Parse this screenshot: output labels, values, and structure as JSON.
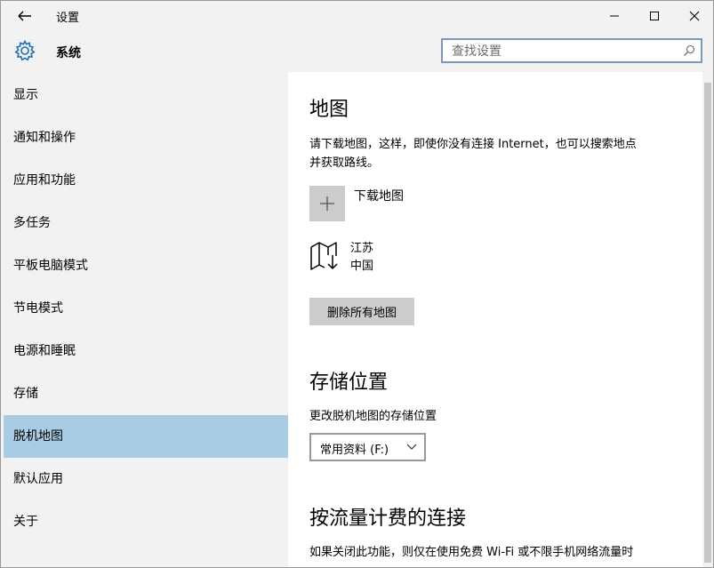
{
  "window": {
    "title": "设置"
  },
  "header": {
    "title": "系统",
    "search_placeholder": "查找设置"
  },
  "sidebar": {
    "items": [
      {
        "label": "显示"
      },
      {
        "label": "通知和操作"
      },
      {
        "label": "应用和功能"
      },
      {
        "label": "多任务"
      },
      {
        "label": "平板电脑模式"
      },
      {
        "label": "节电模式"
      },
      {
        "label": "电源和睡眠"
      },
      {
        "label": "存储"
      },
      {
        "label": "脱机地图"
      },
      {
        "label": "默认应用"
      },
      {
        "label": "关于"
      }
    ],
    "selected_index": 8
  },
  "main": {
    "maps": {
      "heading": "地图",
      "description_line1": "请下载地图，这样，即使你没有连接 Internet，也可以搜索地点",
      "description_line2": "并获取路线。",
      "download_label": "下载地图",
      "region_name": "江苏",
      "region_country": "中国",
      "delete_all_label": "删除所有地图"
    },
    "storage": {
      "heading": "存储位置",
      "description": "更改脱机地图的存储位置",
      "selected_location": "常用资料 (F:)"
    },
    "metered": {
      "heading": "按流量计费的连接",
      "description": "如果关闭此功能，则仅在使用免费 Wi-Fi 或不限手机网络流量时"
    }
  },
  "colors": {
    "selected_nav": "#a8cce4",
    "search_border": "#7b98b9",
    "tile_gray": "#cccccc"
  },
  "icons": {
    "back": "arrow-left-icon",
    "gear": "gear-icon",
    "search": "search-icon",
    "add": "plus-icon",
    "map": "map-download-icon",
    "dropdown": "chevron-down-icon"
  }
}
